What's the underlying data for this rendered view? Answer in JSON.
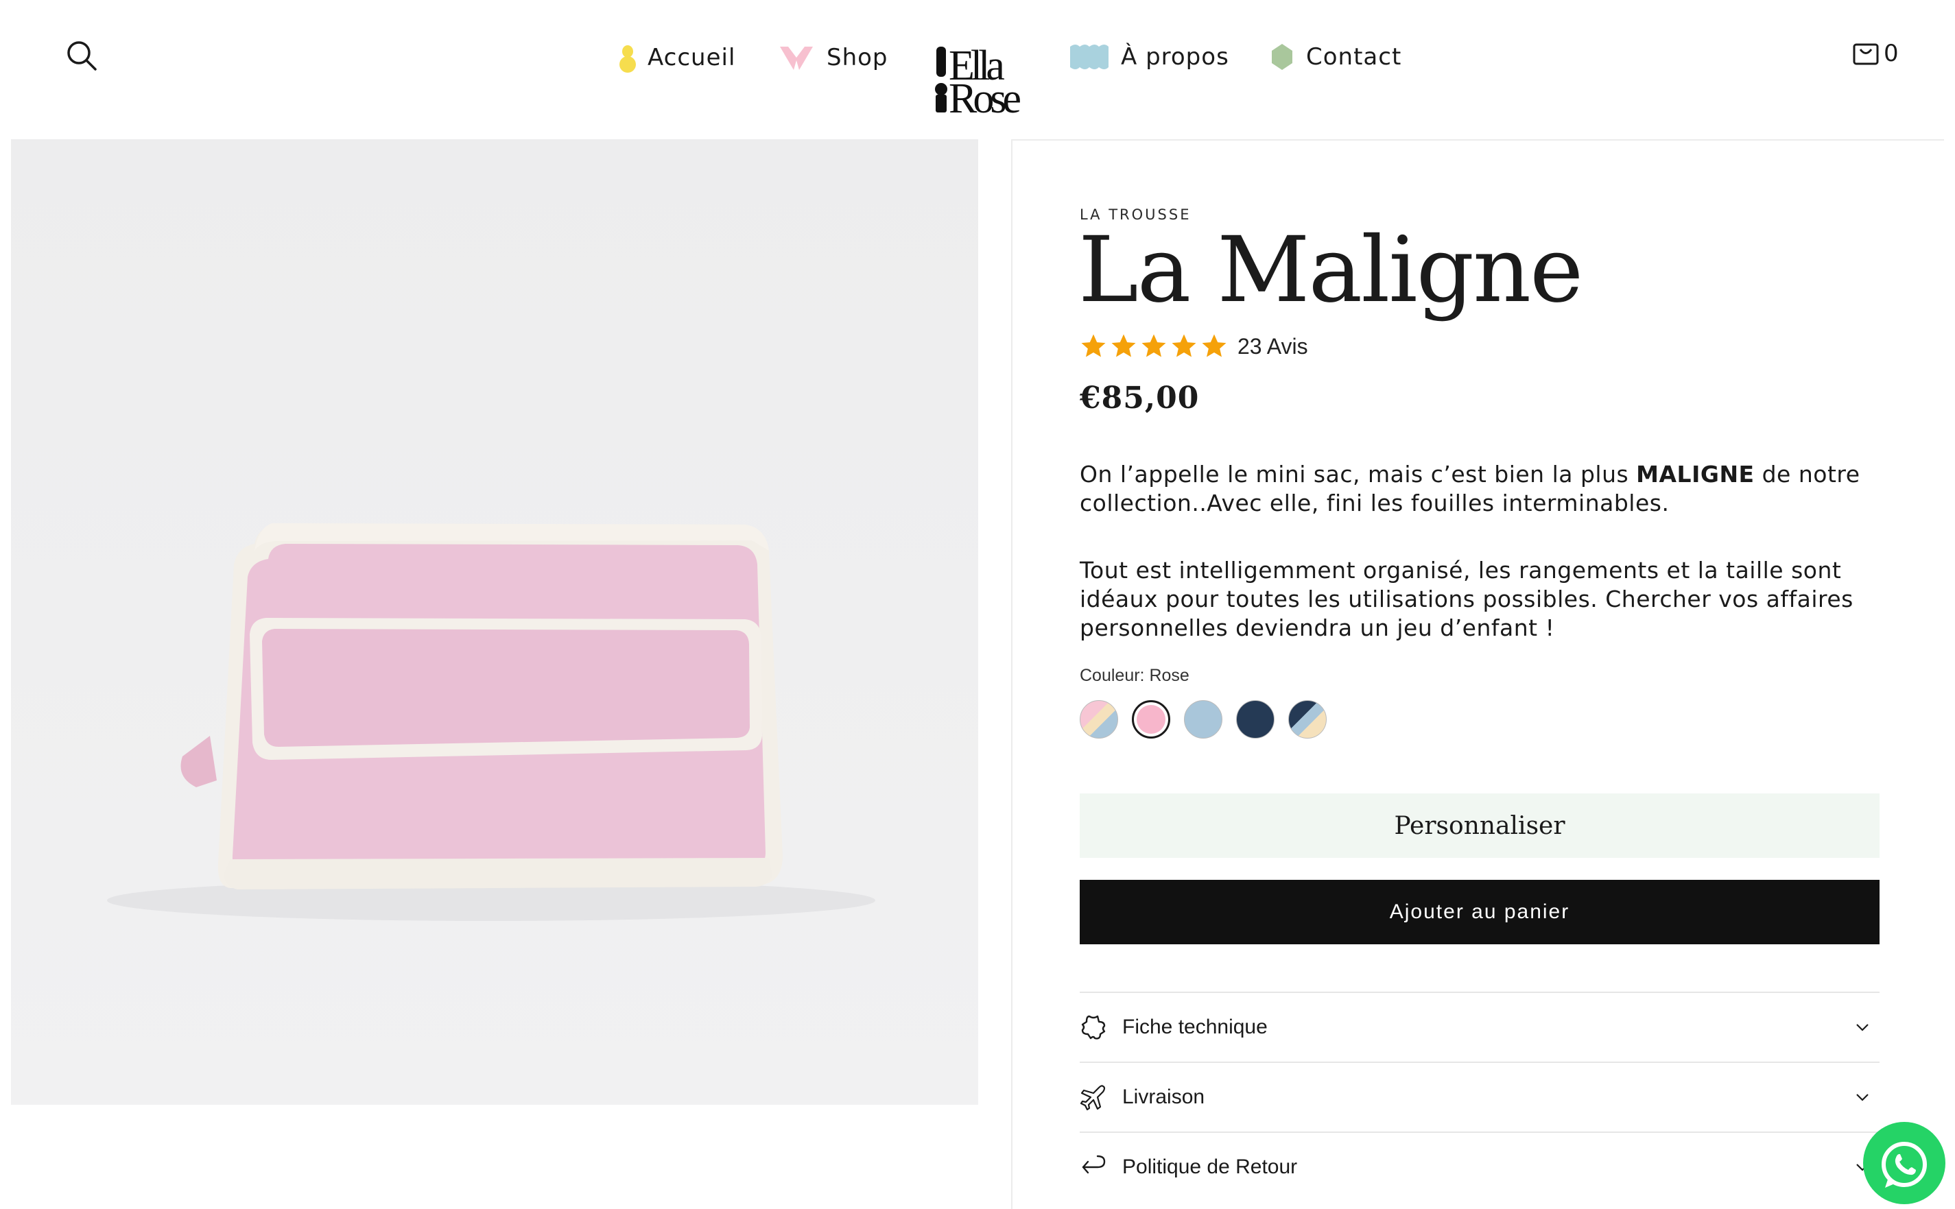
{
  "header": {
    "nav": [
      {
        "label": "Accueil",
        "icon": "yellow-figure-icon"
      },
      {
        "label": "Shop",
        "icon": "pink-bow-icon"
      },
      {
        "label": "À propos",
        "icon": "blue-wave-icon"
      },
      {
        "label": "Contact",
        "icon": "green-leaf-icon"
      }
    ],
    "logo_text": "Ella Rose",
    "cart_count": "0"
  },
  "product": {
    "eyebrow": "LA TROUSSE",
    "title": "La Maligne",
    "rating_stars": 5,
    "reviews": "23 Avis",
    "price": "€85,00",
    "desc1_a": "On l’appelle le mini sac, mais c’est bien la plus ",
    "desc1_bold": "MALIGNE",
    "desc1_b": " de notre collection..Avec elle, fini les fouilles interminables.",
    "desc2": "Tout est intelligemment organisé, les rangements et la taille sont idéaux pour toutes les utilisations possibles. Chercher vos affaires personnelles deviendra un jeu d’enfant !",
    "color_label": "Couleur: Rose",
    "swatches": [
      {
        "name": "rose-beige-bleu"
      },
      {
        "name": "rose",
        "selected": true
      },
      {
        "name": "bleu-ciel"
      },
      {
        "name": "marine"
      },
      {
        "name": "marine-bleu-beige"
      }
    ],
    "personalize_label": "Personnaliser",
    "add_to_cart_label": "Ajouter au panier",
    "accordions": [
      {
        "label": "Fiche technique",
        "icon": "puzzle-badge-icon"
      },
      {
        "label": "Livraison",
        "icon": "airplane-icon"
      },
      {
        "label": "Politique de Retour",
        "icon": "return-arrow-icon"
      }
    ]
  },
  "colors": {
    "accent_pink": "#f7b6cb",
    "light_blue": "#a9c6da",
    "navy": "#253a55",
    "button_black": "#111111",
    "personalize_bg": "#f1f7f2",
    "star": "#f5a10a",
    "whatsapp": "#25d366"
  }
}
